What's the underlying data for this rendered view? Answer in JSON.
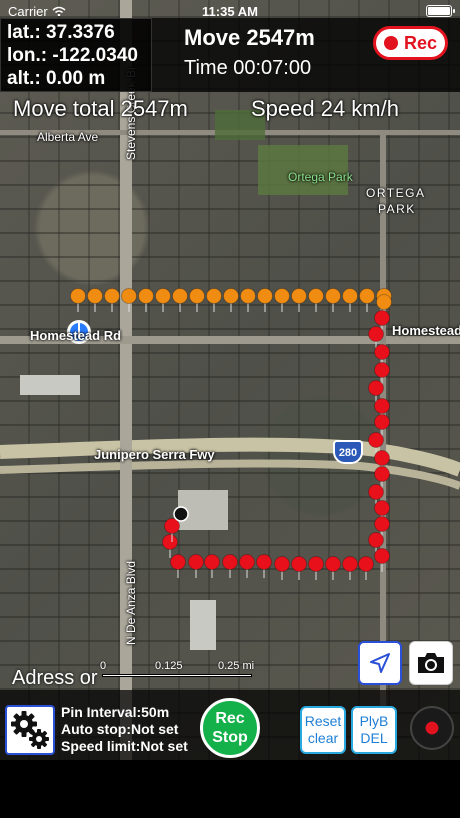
{
  "status_bar": {
    "carrier": "Carrier",
    "time": "11:35 AM"
  },
  "coords": {
    "lat": "lat.: 37.3376",
    "lon": "lon.: -122.0340",
    "alt": "alt.: 0.00 m"
  },
  "header": {
    "move": "Move 2547m",
    "time": "Time 00:07:00",
    "rec_label": "Rec"
  },
  "overlay": {
    "move_total": "Move total 2547m",
    "speed": "Speed 24 km/h"
  },
  "map_labels": {
    "alberta": "Alberta Ave",
    "ortega_park": "Ortega Park",
    "ortega": "ORTEGA",
    "park": "PARK",
    "homestead_left": "Homestead Rd",
    "homestead_right": "Homestead",
    "junipero": "Junipero Serra Fwy",
    "shield": "280",
    "de_anza": "N De Anza Blvd",
    "stelling": "Stevens Creek Bl"
  },
  "scale": {
    "zero": "0",
    "mid": "0.125",
    "end": "0.25 mi"
  },
  "address": "Adress or",
  "settings": {
    "pin_interval": "Pin Interval:50m",
    "auto_stop": "Auto stop:Not set",
    "speed_limit": "Speed limit:Not set"
  },
  "buttons": {
    "rec_stop_line1": "Rec",
    "rec_stop_line2": "Stop",
    "reset_line1": "Reset",
    "reset_line2": "clear",
    "plyb_line1": "PlyB",
    "plyb_line2": "DEL"
  },
  "colors": {
    "rec_red": "#e2121f",
    "pin_orange": "#f08c12",
    "pin_red": "#e8101a",
    "go_green": "#14b04a",
    "accent_blue": "#2a4fd8"
  },
  "icons": {
    "settings": "gear-icon",
    "locate": "location-arrow-icon",
    "camera": "camera-icon",
    "record": "record-disc-icon"
  }
}
